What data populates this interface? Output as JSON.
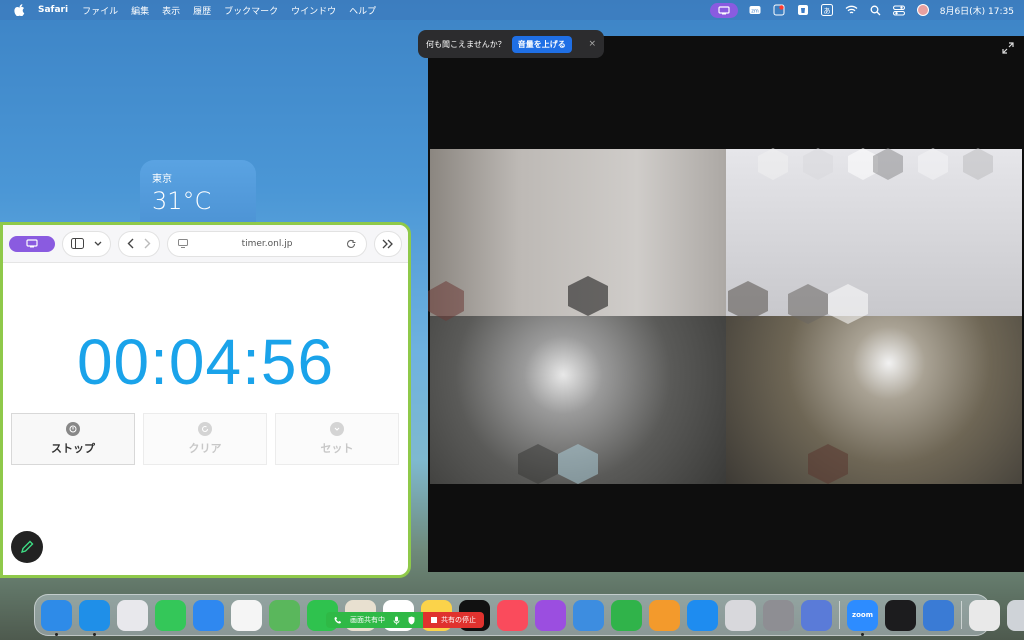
{
  "menubar": {
    "app_name": "Safari",
    "menus": [
      "ファイル",
      "編集",
      "表示",
      "履歴",
      "ブックマーク",
      "ウインドウ",
      "ヘルプ"
    ],
    "clock": "8月6日(木) 17:35",
    "icons": [
      "screen-share-icon",
      "zoom-icon",
      "status-icon",
      "trash-small-icon",
      "input-method-icon",
      "wifi-icon",
      "search-icon",
      "control-center-icon",
      "siri-icon"
    ]
  },
  "weather": {
    "city": "東京",
    "temp": "31°C"
  },
  "browser": {
    "url": "timer.onl.jp"
  },
  "timer": {
    "display": "00:04:56",
    "buttons": {
      "stop": "ストップ",
      "clear": "クリア",
      "set": "セット"
    }
  },
  "notification": {
    "message": "何も聞こえませんか？",
    "action": "音量を上げる",
    "close": "×"
  },
  "share_bar": {
    "sharing": "画面共有中",
    "stop": "共有の停止"
  },
  "dock": {
    "apps": [
      {
        "name": "finder-icon",
        "color": "#2e8be8"
      },
      {
        "name": "safari-icon",
        "color": "#1f8fe8"
      },
      {
        "name": "launchpad-icon",
        "color": "#e8e8ec"
      },
      {
        "name": "messages-icon",
        "color": "#34c759"
      },
      {
        "name": "mail-icon",
        "color": "#2f88f0"
      },
      {
        "name": "photos-icon",
        "color": "#f5f5f5"
      },
      {
        "name": "maps-icon",
        "color": "#5ab75c"
      },
      {
        "name": "facetime-icon",
        "color": "#2fc24e"
      },
      {
        "name": "contacts-icon",
        "color": "#e8e0d0"
      },
      {
        "name": "calendar-icon",
        "color": "#ffffff"
      },
      {
        "name": "notes-icon",
        "color": "#fbd34a"
      },
      {
        "name": "appletv-icon",
        "color": "#111111"
      },
      {
        "name": "music-icon",
        "color": "#fa4b5c"
      },
      {
        "name": "podcasts-icon",
        "color": "#9b4ee0"
      },
      {
        "name": "keynote-icon",
        "color": "#3d8de0"
      },
      {
        "name": "numbers-icon",
        "color": "#30b34a"
      },
      {
        "name": "pages-icon",
        "color": "#f39a2c"
      },
      {
        "name": "appstore-icon",
        "color": "#1e8cf0"
      },
      {
        "name": "help-icon",
        "color": "#d8d8dc"
      },
      {
        "name": "system-preferences-icon",
        "color": "#8e8e93"
      },
      {
        "name": "simulator-icon",
        "color": "#5a7bd8"
      }
    ],
    "right_apps": [
      {
        "name": "zoom-app-icon",
        "color": "#2d8cff",
        "label": "zoom"
      },
      {
        "name": "stocks-icon",
        "color": "#1c1c1e"
      },
      {
        "name": "disk-utility-icon",
        "color": "#3a7bd5"
      }
    ],
    "trash_apps": [
      {
        "name": "documents-folder-icon",
        "color": "#e9e9e9"
      },
      {
        "name": "trash-icon",
        "color": "#cfd3d8"
      }
    ]
  }
}
